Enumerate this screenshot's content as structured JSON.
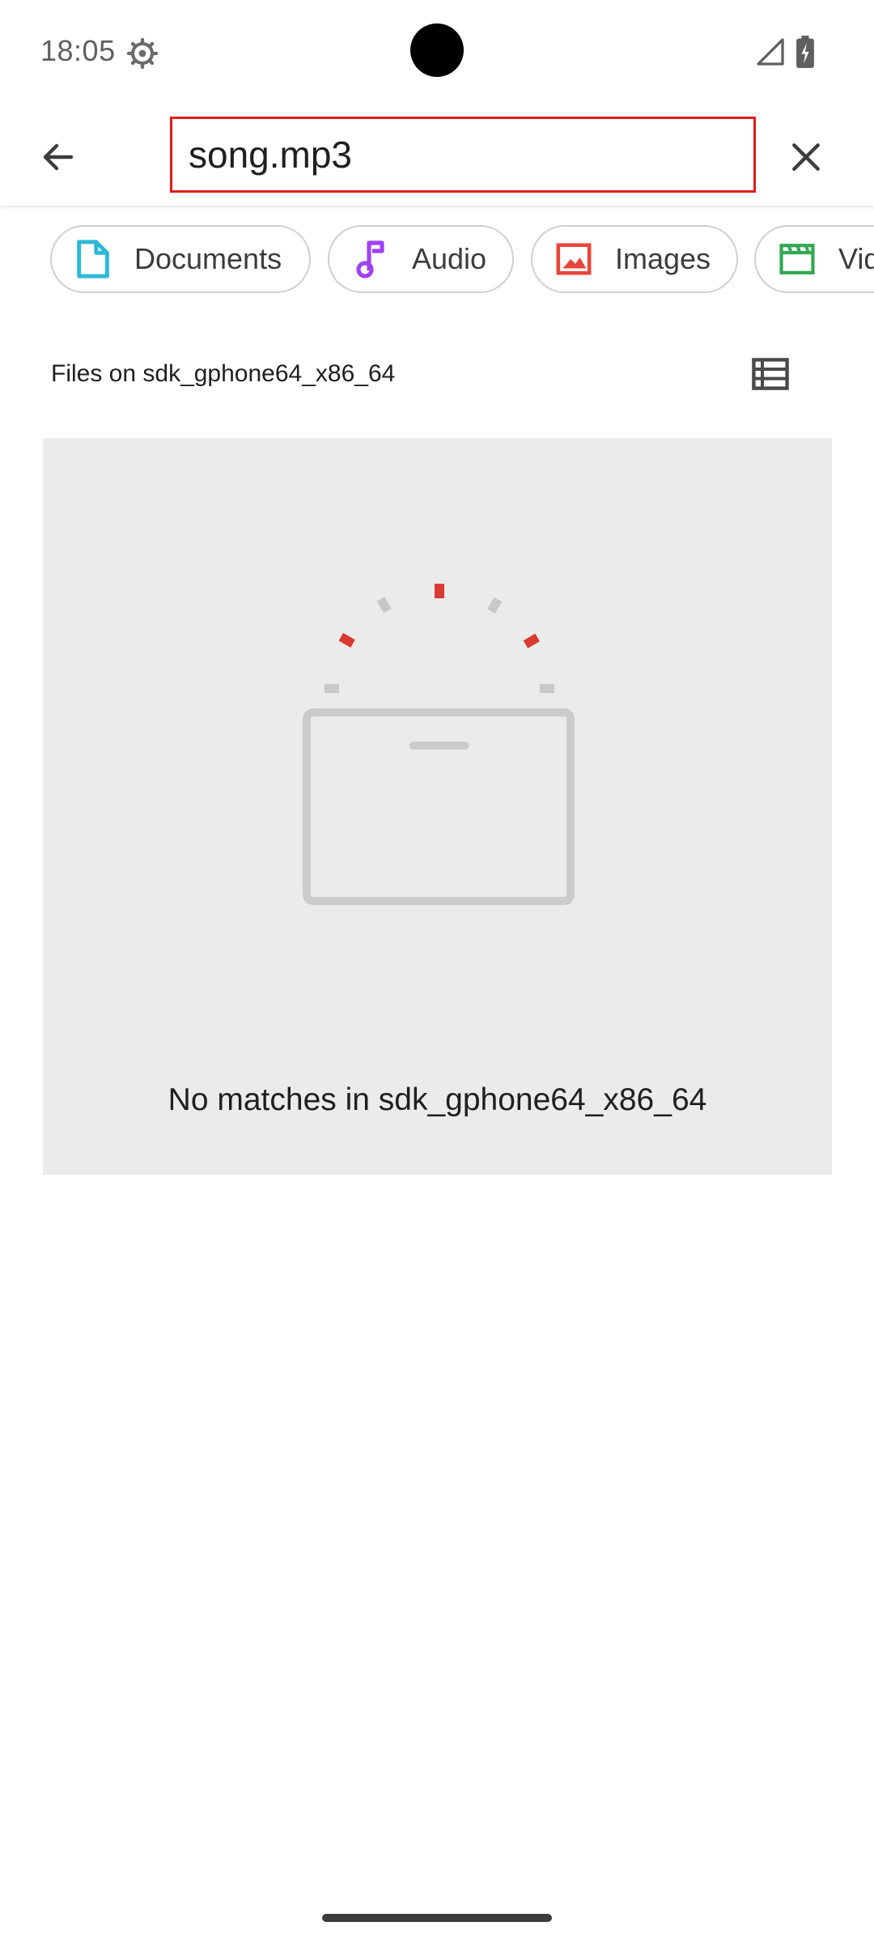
{
  "status_bar": {
    "time": "18:05",
    "settings_icon": "gear-icon",
    "signal_icon": "cell-signal-icon",
    "battery_icon": "battery-charging-icon"
  },
  "search": {
    "query": "song.mp3",
    "back_icon": "arrow-back-icon",
    "clear_icon": "close-icon",
    "highlight_color": "#e11b1b"
  },
  "chips": [
    {
      "label": "Documents",
      "icon": "document-icon",
      "color": "#2fb8d6"
    },
    {
      "label": "Audio",
      "icon": "music-note-icon",
      "color": "#a142f4"
    },
    {
      "label": "Images",
      "icon": "image-icon",
      "color": "#e8453c"
    },
    {
      "label": "Videos",
      "icon": "clapperboard-icon",
      "color": "#34a853"
    }
  ],
  "section": {
    "title": "Files on sdk_gphone64_x86_64",
    "view_toggle_icon": "list-view-icon"
  },
  "empty_state": {
    "message": "No matches in sdk_gphone64_x86_64",
    "illustration": "empty-box-icon",
    "accent_color": "#d93a32"
  }
}
